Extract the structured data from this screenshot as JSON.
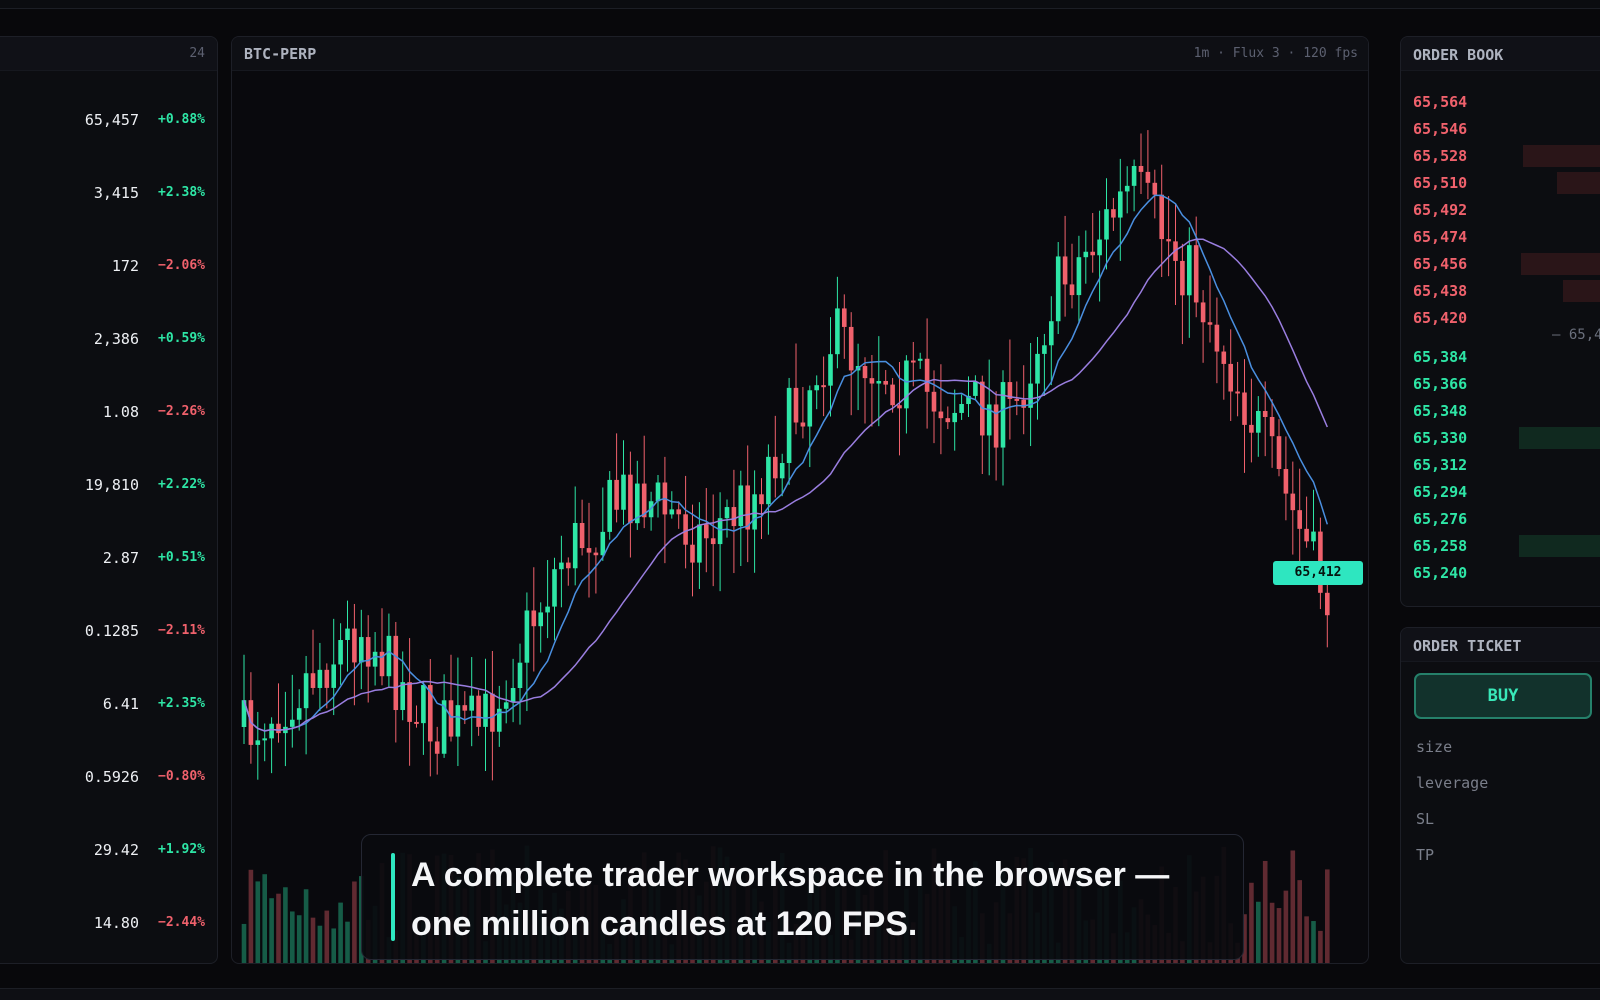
{
  "watchlist": {
    "count": "24",
    "rows": [
      {
        "price": "65,457",
        "change": "+0.88%",
        "dir": "up"
      },
      {
        "price": "3,415",
        "change": "+2.38%",
        "dir": "up"
      },
      {
        "price": "172",
        "change": "−2.06%",
        "dir": "down"
      },
      {
        "price": "2,386",
        "change": "+0.59%",
        "dir": "up"
      },
      {
        "price": "1.08",
        "change": "−2.26%",
        "dir": "down"
      },
      {
        "price": "19,810",
        "change": "+2.22%",
        "dir": "up"
      },
      {
        "price": "2.87",
        "change": "+0.51%",
        "dir": "up"
      },
      {
        "price": "0.1285",
        "change": "−2.11%",
        "dir": "down"
      },
      {
        "price": "6.41",
        "change": "+2.35%",
        "dir": "up"
      },
      {
        "price": "0.5926",
        "change": "−0.80%",
        "dir": "down"
      },
      {
        "price": "29.42",
        "change": "+1.92%",
        "dir": "up"
      },
      {
        "price": "14.80",
        "change": "−2.44%",
        "dir": "down"
      }
    ]
  },
  "chart": {
    "symbol": "BTC-PERP",
    "meta": "1m · Flux 3 · 120 fps",
    "last_price": "65,412",
    "colors": {
      "up": "#2ee6a6",
      "down": "#f0616c",
      "ma_fast": "#4a8fe0",
      "ma_slow": "#9a7ee0"
    }
  },
  "caption": {
    "text": "A complete trader workspace in the browser — one million candles at 120 FPS."
  },
  "orderbook": {
    "title": "ORDER BOOK",
    "asks": [
      "65,564",
      "65,546",
      "65,528",
      "65,510",
      "65,492",
      "65,474",
      "65,456",
      "65,438",
      "65,420"
    ],
    "mid": "— 65,4",
    "bids": [
      "65,384",
      "65,366",
      "65,348",
      "65,330",
      "65,312",
      "65,294",
      "65,276",
      "65,258",
      "65,240"
    ]
  },
  "ticket": {
    "title": "ORDER TICKET",
    "buy_label": "BUY",
    "fields": [
      "size",
      "leverage",
      "SL",
      "TP"
    ]
  }
}
